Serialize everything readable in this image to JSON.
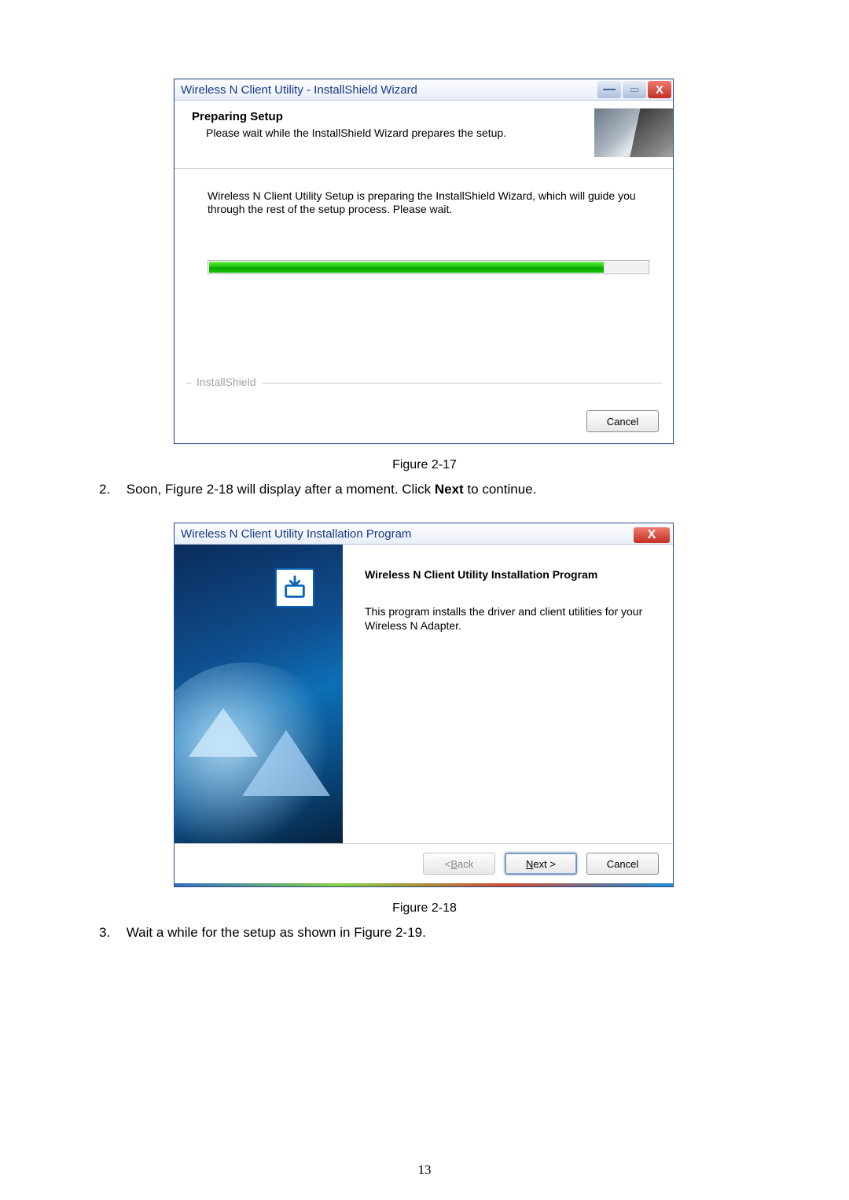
{
  "dialog1": {
    "title": "Wireless N Client Utility - InstallShield Wizard",
    "header_title": "Preparing Setup",
    "header_sub": "Please wait while the InstallShield Wizard prepares the setup.",
    "body_text": "Wireless N Client Utility Setup is preparing the InstallShield Wizard, which will guide you through the rest of the setup process. Please wait.",
    "progress_percent": 90,
    "brand": "InstallShield",
    "cancel_label": "Cancel"
  },
  "caption1": "Figure 2-17",
  "step2_prefix": "Soon, Figure 2-18 will display after a moment. Click ",
  "step2_bold": "Next",
  "step2_suffix": " to continue.",
  "dialog2": {
    "title": "Wireless N Client Utility Installation Program",
    "heading": "Wireless N Client Utility Installation Program",
    "desc": "This program installs the driver and client utilities for your Wireless N Adapter.",
    "back_label": "< Back",
    "next_label": "Next >",
    "cancel_label": "Cancel"
  },
  "caption2": "Figure 2-18",
  "step3_text": "Wait a while for the setup as shown in Figure 2-19.",
  "page_number": "13"
}
